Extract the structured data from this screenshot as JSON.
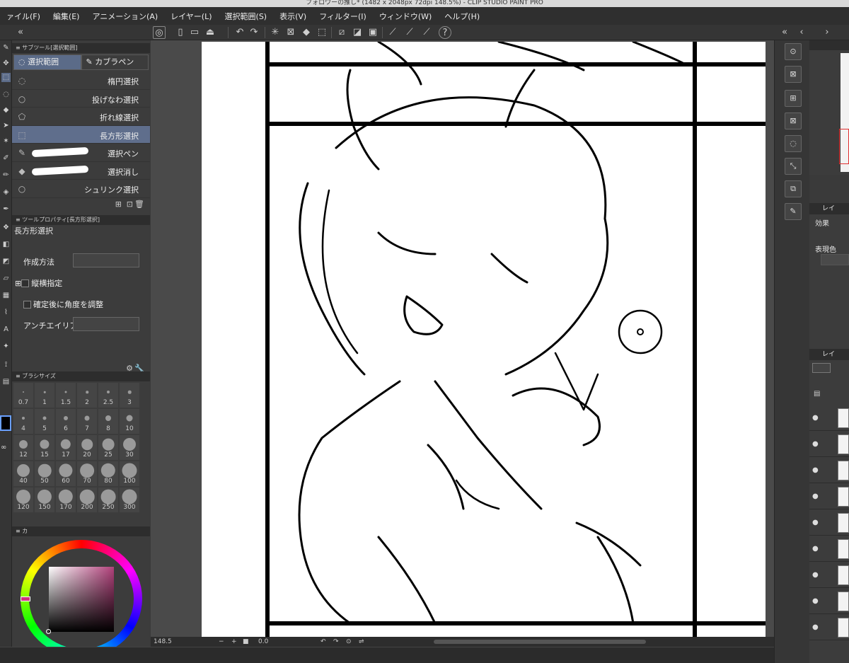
{
  "window": {
    "title": "フォロワーの推し* (1482 x 2048px 72dpi 148.5%) - CLIP STUDIO PAINT PRO"
  },
  "menu": [
    "ァイル(F)",
    "編集(E)",
    "アニメーション(A)",
    "レイヤー(L)",
    "選択範囲(S)",
    "表示(V)",
    "フィルター(I)",
    "ウィンドウ(W)",
    "ヘルプ(H)"
  ],
  "subtool": {
    "panel_title": "サブツール[選択範囲]",
    "tabs": [
      "選択範囲",
      "カブラペン"
    ],
    "items": [
      "楕円選択",
      "投げなわ選択",
      "折れ線選択",
      "長方形選択",
      "選択ペン",
      "選択消し",
      "シュリンク選択"
    ],
    "selected_index": 3
  },
  "tool_property": {
    "panel_title": "ツールプロパティ[長方形選択]",
    "tool_name": "長方形選択",
    "rows": {
      "create_method": "作成方法",
      "aspect": "縦横指定",
      "adjust_angle": "確定後に角度を調整",
      "antialias": "アンチエイリアス"
    }
  },
  "brush_size": {
    "panel_title": "ブラシサイズ",
    "sizes": [
      "0.7",
      "1",
      "1.5",
      "2",
      "2.5",
      "3",
      "4",
      "5",
      "6",
      "7",
      "8",
      "10",
      "12",
      "15",
      "17",
      "20",
      "25",
      "30",
      "40",
      "50",
      "60",
      "70",
      "80",
      "100",
      "120",
      "150",
      "170",
      "200",
      "250",
      "300"
    ]
  },
  "color": {
    "panel_tab": "カ",
    "main_hex": "#b0407a"
  },
  "status": {
    "zoom": "148.5",
    "angle": "0.0"
  },
  "right": {
    "effect_label": "効果",
    "display_color_label": "表現色",
    "layer_tab": "レイ"
  }
}
